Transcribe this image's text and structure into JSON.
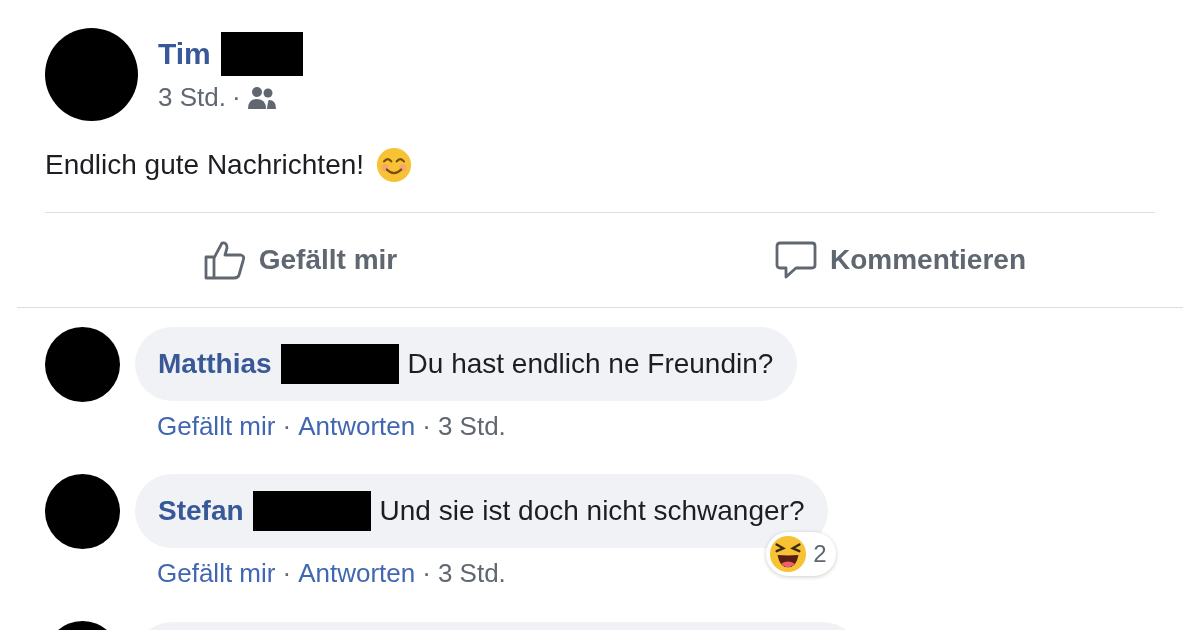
{
  "post": {
    "author": "Tim",
    "time": "3 Std.",
    "separator": "·",
    "text": "Endlich gute Nachrichten!"
  },
  "actions": [
    {
      "kind": "like",
      "label": "Gefällt mir"
    },
    {
      "kind": "comment",
      "label": "Kommentieren"
    }
  ],
  "comments": [
    {
      "author": "Matthias",
      "text": "Du hast endlich ne Freundin?",
      "actions": [
        "Gefällt mir",
        "Antworten"
      ],
      "time": "3 Std."
    },
    {
      "author": "Stefan",
      "text": "Und sie ist doch nicht schwanger?",
      "actions": [
        "Gefällt mir",
        "Antworten"
      ],
      "time": "3 Std.",
      "reaction_count": "2"
    }
  ],
  "partial_comment": true,
  "separator": "·"
}
